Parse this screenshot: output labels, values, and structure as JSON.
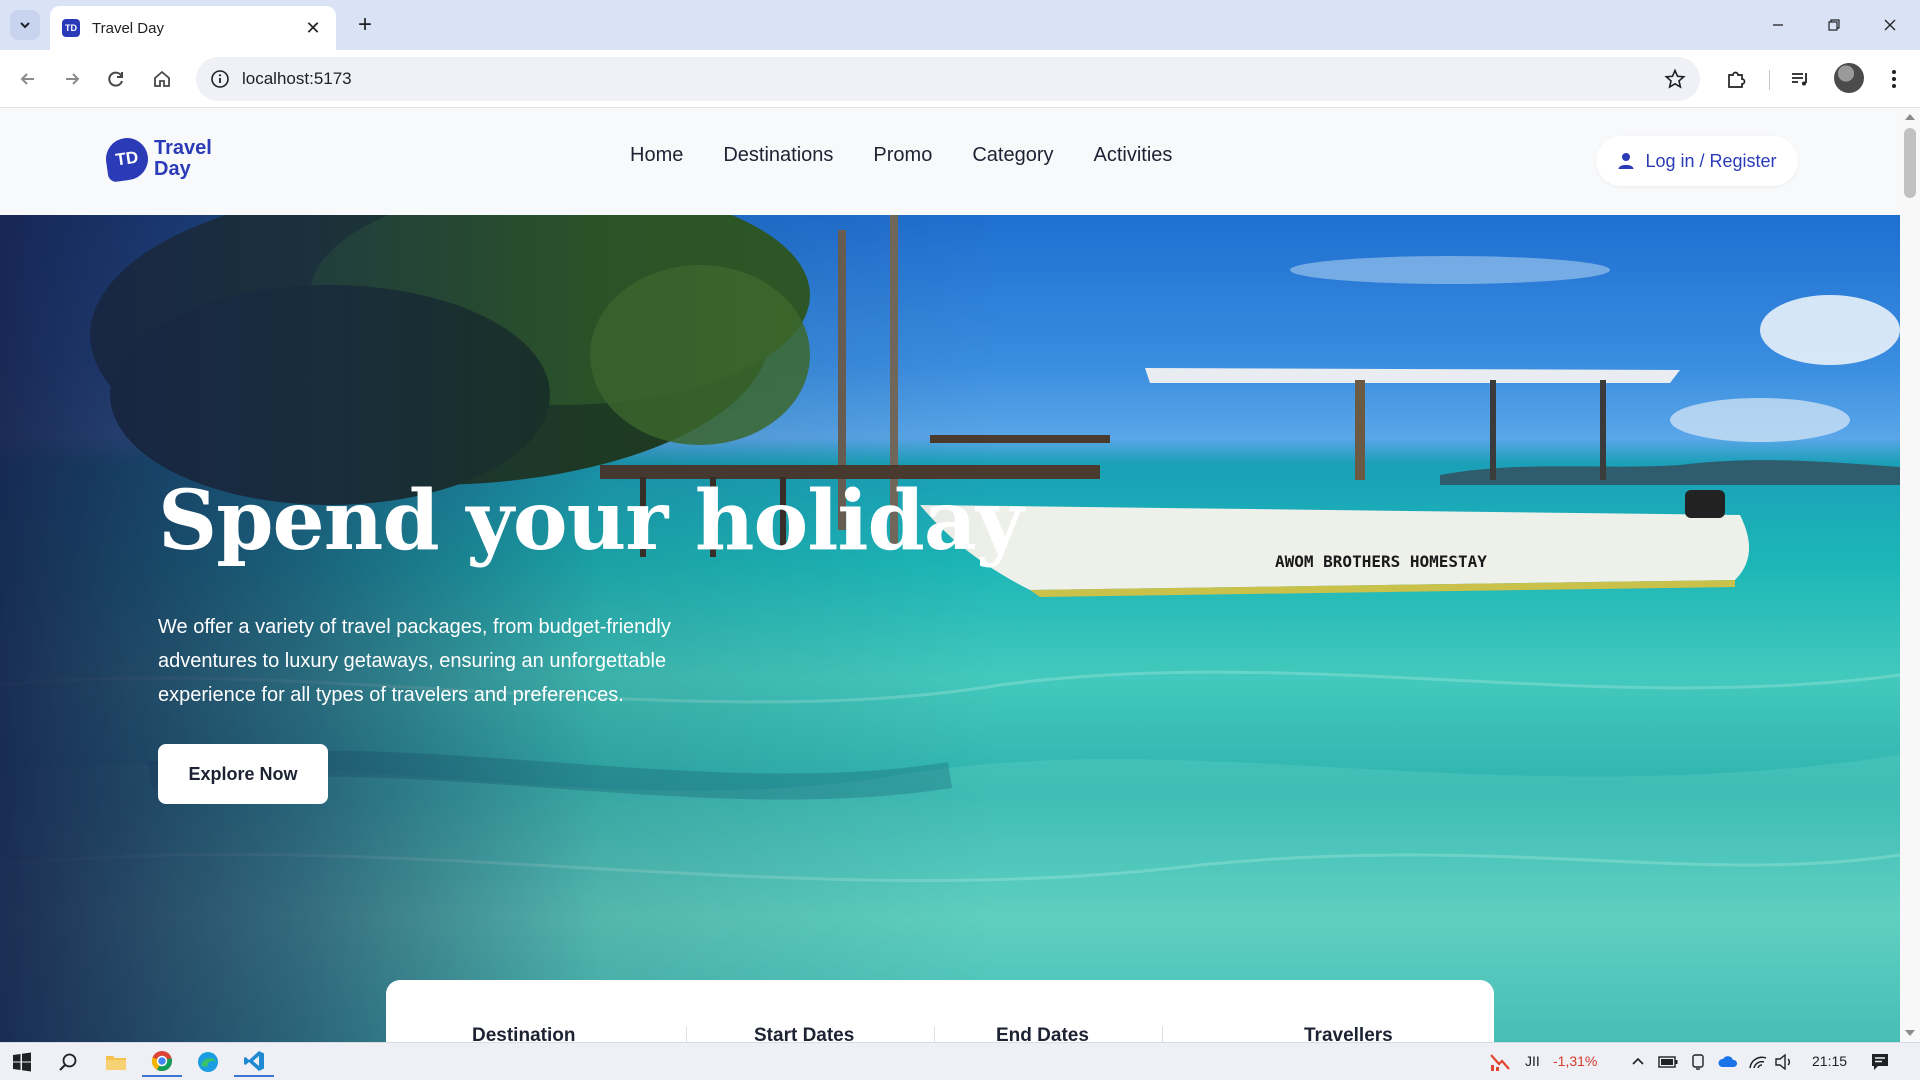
{
  "browser": {
    "tab_title": "Travel Day",
    "url": "localhost:5173"
  },
  "site": {
    "logo_mark": "TD",
    "logo_text": "Travel Day",
    "nav": [
      "Home",
      "Destinations",
      "Promo",
      "Category",
      "Activities"
    ],
    "login_label": "Log in / Register",
    "brand_color": "#2b3bb8"
  },
  "hero": {
    "title": "Spend your holiday",
    "description": "We offer a variety of travel packages, from budget-friendly adventures to luxury getaways, ensuring an unforgettable experience for all types of travelers and preferences.",
    "cta_label": "Explore Now"
  },
  "search": {
    "fields": [
      "Destination",
      "Start Dates",
      "End Dates",
      "Travellers"
    ]
  },
  "taskbar": {
    "stock_change": "-1,31%",
    "clock": "21:15"
  }
}
